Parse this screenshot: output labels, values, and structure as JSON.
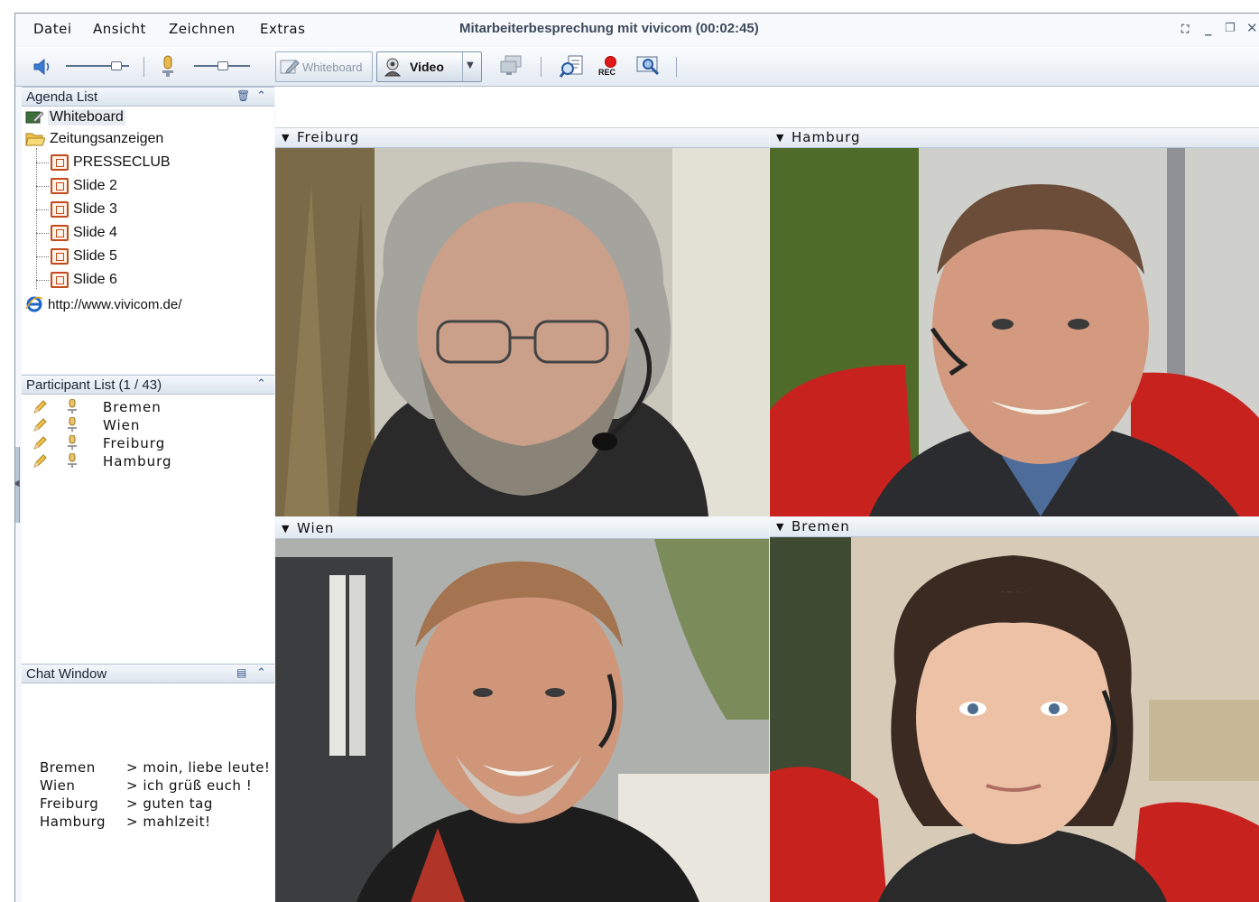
{
  "menu": {
    "datei": "Datei",
    "ansicht": "Ansicht",
    "zeichnen": "Zeichnen",
    "extras": "Extras"
  },
  "window_title": "Mitarbeiterbesprechung mit vivicom (00:02:45)",
  "toolbar": {
    "whiteboard_label": "Whiteboard",
    "video_label": "Video",
    "rec_label": "REC"
  },
  "agenda": {
    "title": "Agenda List",
    "items": [
      {
        "label": "Whiteboard",
        "icon": "whiteboard-icon"
      },
      {
        "label": "Zeitungsanzeigen",
        "icon": "folder-open-icon"
      },
      {
        "label": "PRESSECLUB",
        "icon": "slide-icon"
      },
      {
        "label": "Slide 2",
        "icon": "slide-icon"
      },
      {
        "label": "Slide 3",
        "icon": "slide-icon"
      },
      {
        "label": "Slide 4",
        "icon": "slide-icon"
      },
      {
        "label": "Slide 5",
        "icon": "slide-icon"
      },
      {
        "label": "Slide 6",
        "icon": "slide-icon"
      },
      {
        "label": "http://www.vivicom.de/",
        "icon": "web-link-icon"
      }
    ]
  },
  "participants": {
    "title": "Participant List (1 / 43)",
    "items": [
      "Bremen",
      "Wien",
      "Freiburg",
      "Hamburg"
    ]
  },
  "chat": {
    "title": "Chat Window",
    "messages": [
      {
        "name": "Bremen",
        "text": "> moin, liebe leute!"
      },
      {
        "name": "Wien",
        "text": "> ich grüß euch !"
      },
      {
        "name": "Freiburg",
        "text": "> guten tag"
      },
      {
        "name": "Hamburg",
        "text": "> mahlzeit!"
      }
    ]
  },
  "videos": [
    "Freiburg",
    "Hamburg",
    "Wien",
    "Bremen"
  ],
  "colors": {
    "accent": "#3a5a8a",
    "panel_header": "#dbe4ee",
    "record_red": "#e01a1a"
  }
}
